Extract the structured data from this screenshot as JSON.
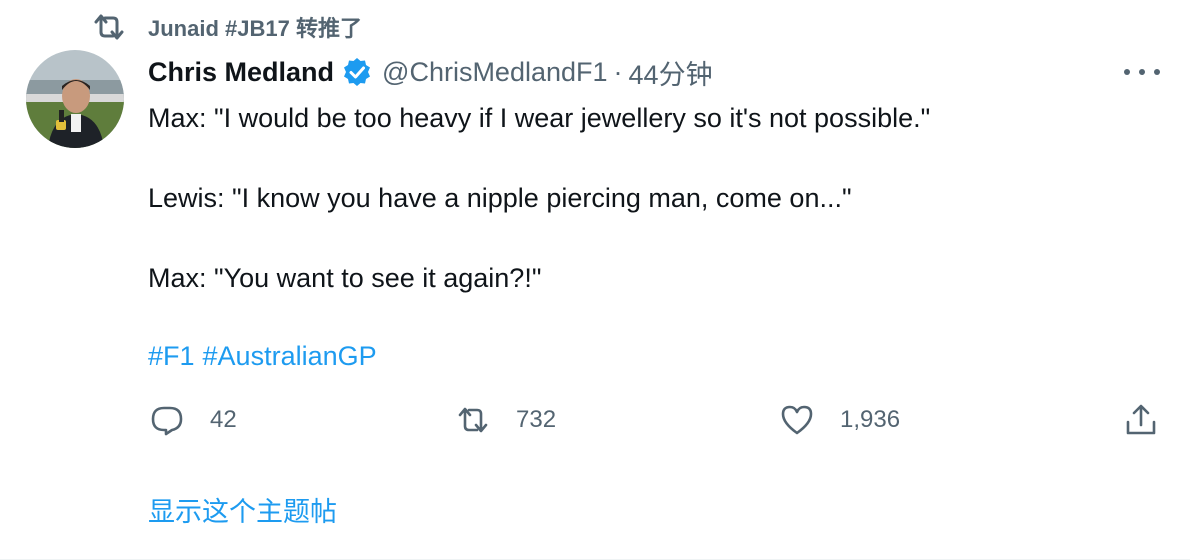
{
  "retweet": {
    "label": "Junaid #JB17 转推了"
  },
  "author": {
    "name": "Chris Medland",
    "handle": "@ChrisMedlandF1",
    "separator": "·",
    "time": "44分钟"
  },
  "tweet": {
    "lines": [
      "Max: \"I would be too heavy if I wear jewellery so it's not possible.\"",
      "Lewis: \"I know you have a nipple piercing man, come on...\"",
      "Max: \"You want to see it again?!\""
    ],
    "hashtags": [
      "#F1",
      "#AustralianGP"
    ]
  },
  "actions": {
    "reply_count": "42",
    "retweet_count": "732",
    "like_count": "1,936"
  },
  "show_thread": "显示这个主题帖",
  "colors": {
    "accent": "#1d9bf0",
    "muted": "#536471",
    "text": "#0f1419"
  },
  "icons": [
    "retweet-icon",
    "verified-badge-icon",
    "more-icon",
    "reply-icon",
    "like-icon",
    "share-icon"
  ]
}
